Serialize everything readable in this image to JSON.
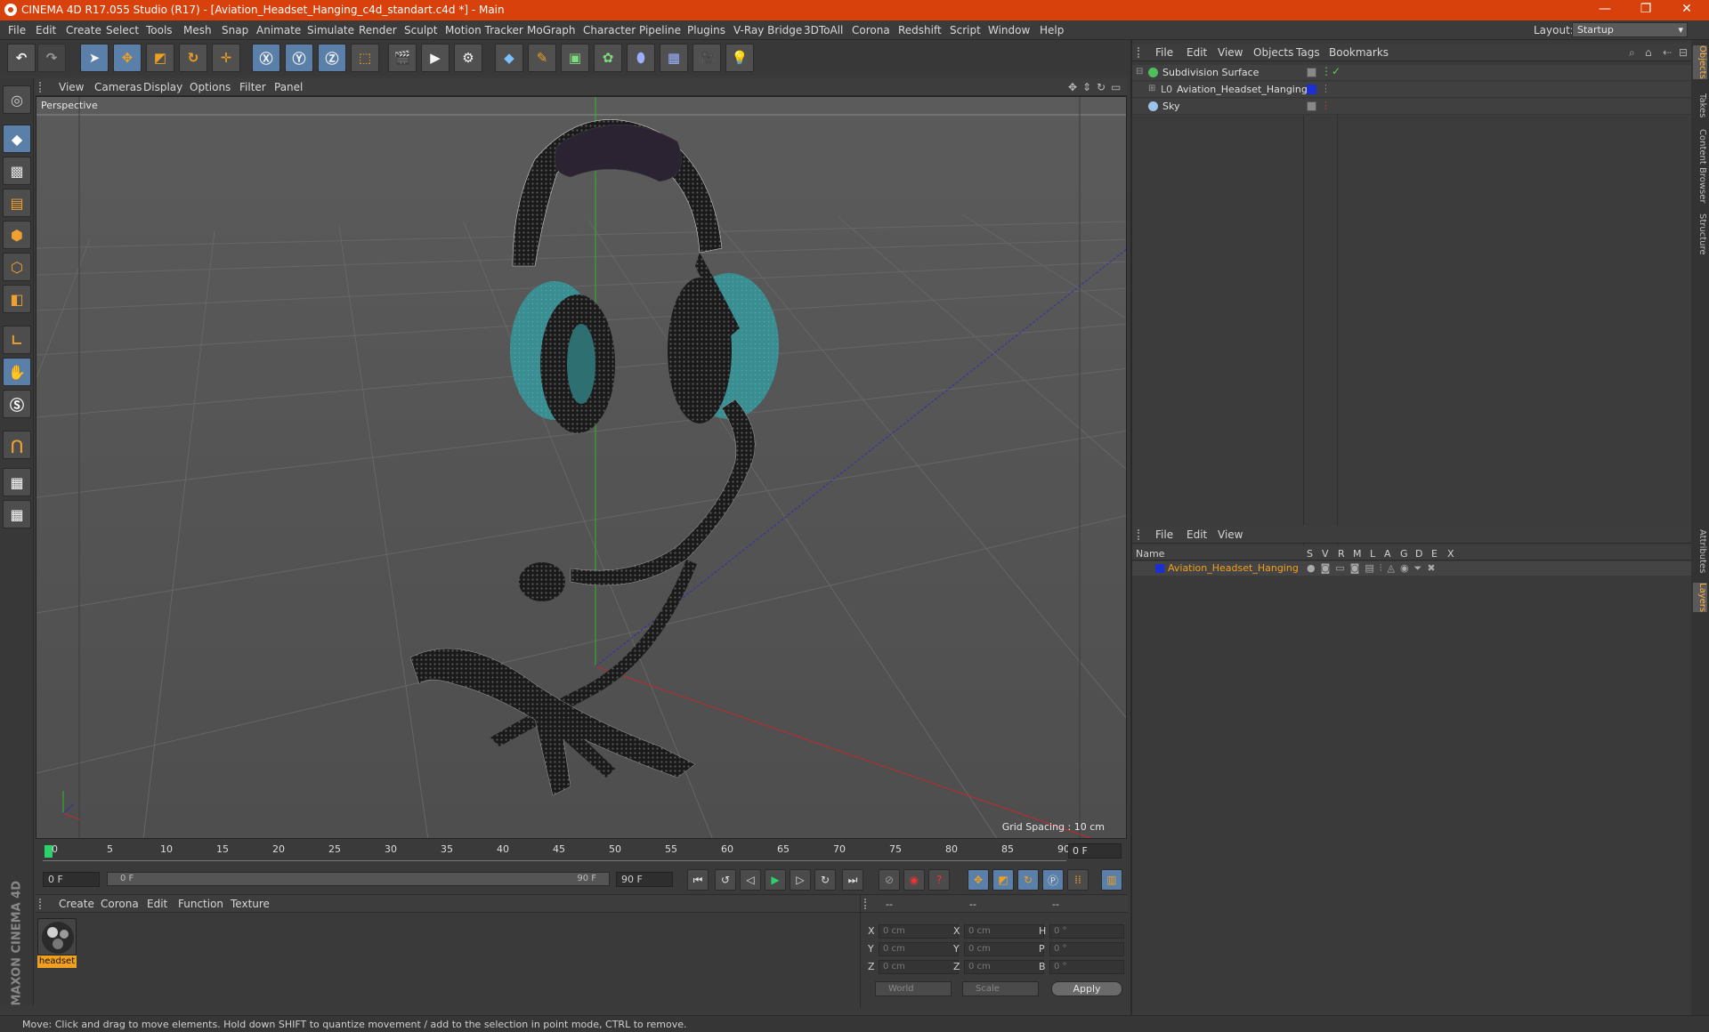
{
  "window": {
    "title": "CINEMA 4D R17.055 Studio (R17) - [Aviation_Headset_Hanging_c4d_standart.c4d *] - Main",
    "controls": [
      "—",
      "❐",
      "✕"
    ]
  },
  "menu": [
    "File",
    "Edit",
    "Create",
    "Select",
    "Tools",
    "Mesh",
    "Snap",
    "Animate",
    "Simulate",
    "Render",
    "Sculpt",
    "Motion Tracker",
    "MoGraph",
    "Character",
    "Pipeline",
    "Plugins",
    "V-Ray Bridge",
    "3DToAll",
    "Corona",
    "Redshift",
    "Script",
    "Window",
    "Help"
  ],
  "layout": {
    "label": "Layout:",
    "value": "Startup"
  },
  "viewport": {
    "menu": [
      "View",
      "Cameras",
      "Display",
      "Options",
      "Filter",
      "Panel"
    ],
    "label": "Perspective",
    "grid_spacing": "Grid Spacing : 10 cm"
  },
  "timeline": {
    "ticks": [
      "0",
      "5",
      "10",
      "15",
      "20",
      "25",
      "30",
      "35",
      "40",
      "45",
      "50",
      "55",
      "60",
      "65",
      "70",
      "75",
      "80",
      "85",
      "90"
    ],
    "current_frame": "0 F"
  },
  "transport": {
    "start": "0 F",
    "slider_start": "0 F",
    "slider_end": "90 F",
    "end": "90 F"
  },
  "materials": {
    "menu": [
      "Create",
      "Corona",
      "Edit",
      "Function",
      "Texture"
    ],
    "items": [
      {
        "name": "headset"
      }
    ]
  },
  "coords": {
    "headers": [
      "--",
      "--",
      "--"
    ],
    "rows": [
      {
        "l1": "X",
        "v1": "0 cm",
        "l2": "X",
        "v2": "0 cm",
        "l3": "H",
        "v3": "0 °"
      },
      {
        "l1": "Y",
        "v1": "0 cm",
        "l2": "Y",
        "v2": "0 cm",
        "l3": "P",
        "v3": "0 °"
      },
      {
        "l1": "Z",
        "v1": "0 cm",
        "l2": "Z",
        "v2": "0 cm",
        "l3": "B",
        "v3": "0 °"
      }
    ],
    "world": "World",
    "scale": "Scale",
    "apply": "Apply"
  },
  "objects": {
    "menu": [
      "File",
      "Edit",
      "View",
      "Objects",
      "Tags",
      "Bookmarks"
    ],
    "items": [
      {
        "name": "Subdivision Surface"
      },
      {
        "name": "Aviation_Headset_Hanging"
      },
      {
        "name": "Sky"
      }
    ]
  },
  "layers": {
    "menu": [
      "File",
      "Edit",
      "View"
    ],
    "columns": [
      "Name",
      "S",
      "V",
      "R",
      "M",
      "L",
      "A",
      "G",
      "D",
      "E",
      "X"
    ],
    "items": [
      {
        "name": "Aviation_Headset_Hanging"
      }
    ]
  },
  "side_tabs": [
    "Objects",
    "Takes",
    "Content Browser",
    "Structure",
    "Attributes",
    "Layers"
  ],
  "branding": "MAXON CINEMA 4D",
  "status": "Move: Click and drag to move elements. Hold down SHIFT to quantize movement / add to the selection in point mode, CTRL to remove.",
  "colors": {
    "accent": "#d9410c",
    "highlight": "#f0a020",
    "selection_blue": "#5a7fa8"
  }
}
